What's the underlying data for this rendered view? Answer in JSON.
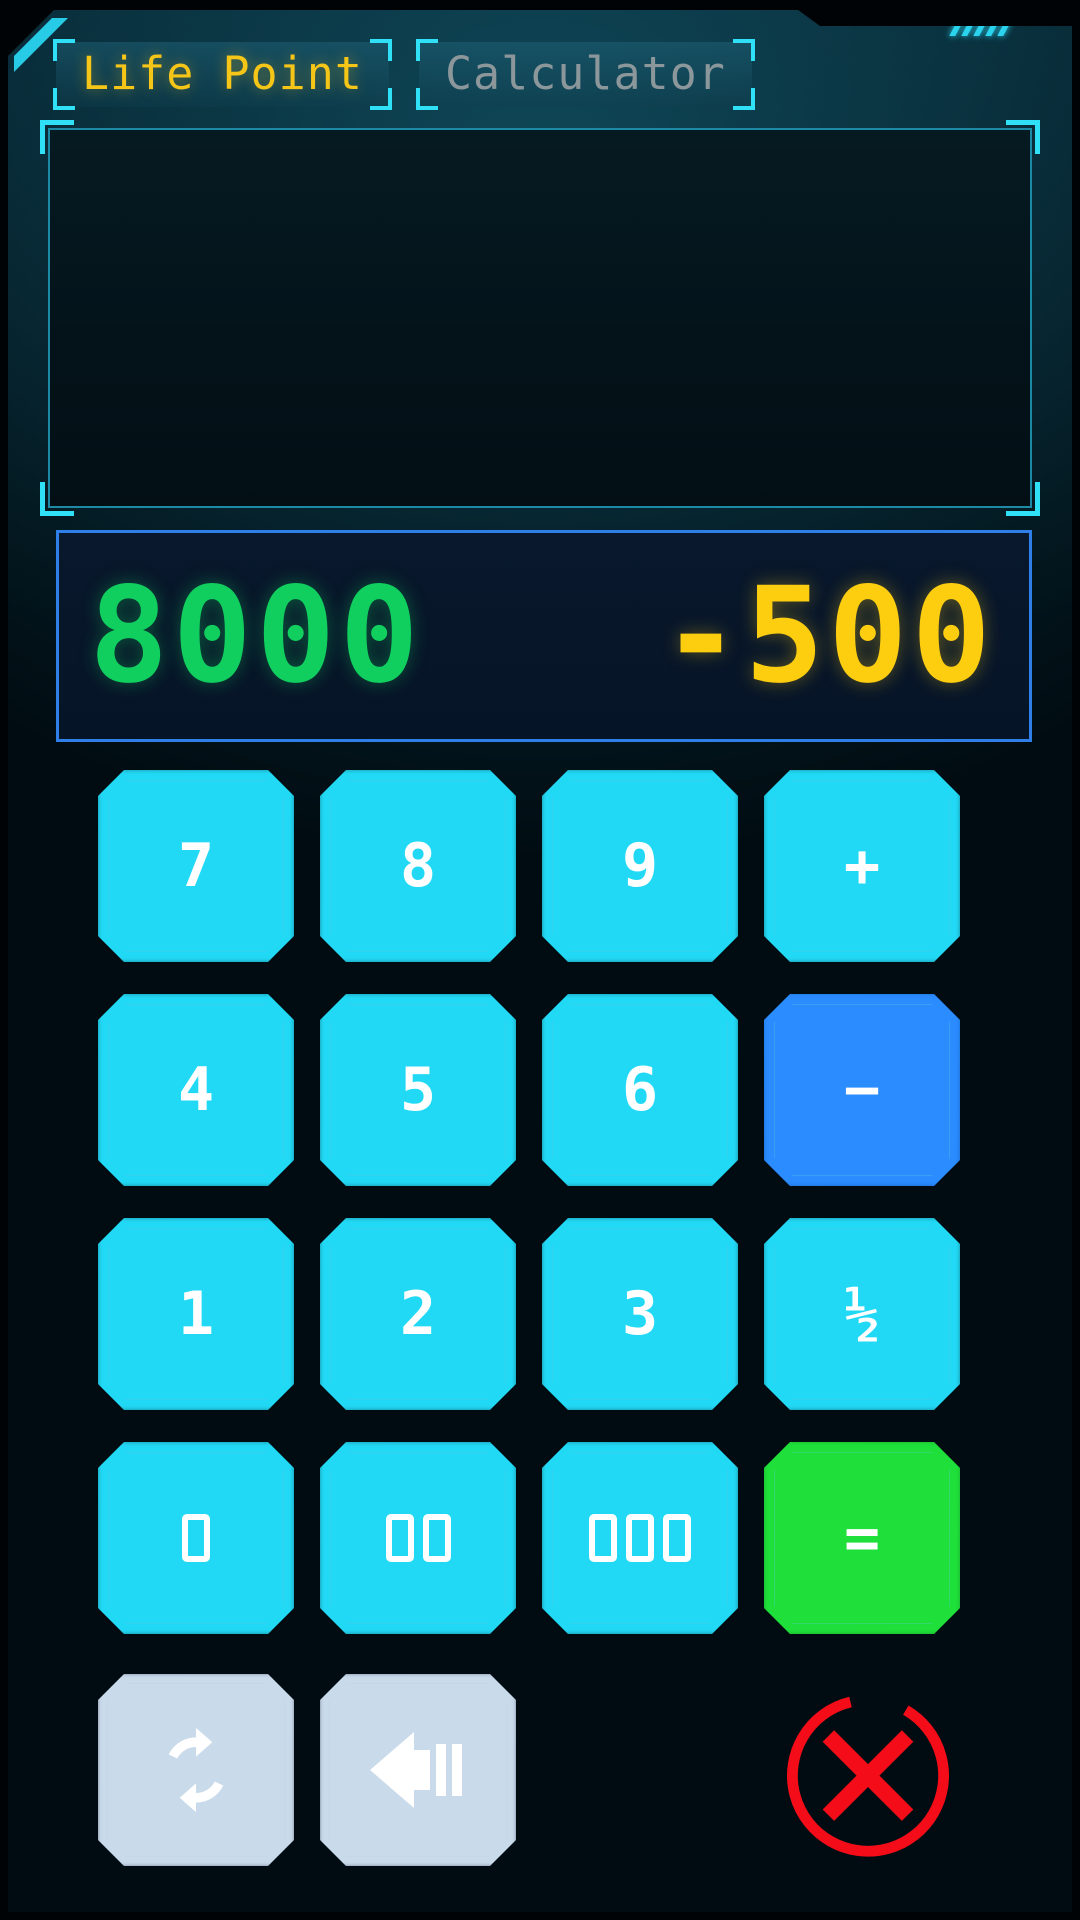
{
  "window": {
    "title": "Life Point Calculator",
    "background_color": "#03171f",
    "accent_color": "#2fe0f7"
  },
  "tabs": [
    {
      "id": "life-point",
      "label": "Life Point",
      "active": true,
      "color": "#f5c518"
    },
    {
      "id": "calculator",
      "label": "Calculator",
      "active": false,
      "color": "#8b979b"
    }
  ],
  "log_panel": {
    "entries": [],
    "empty_text": ""
  },
  "display": {
    "life_points": "8000",
    "life_points_color": "#10cf5e",
    "pending_delta": "-500",
    "pending_delta_color": "#fdcd10",
    "border_color": "#2f7fe8"
  },
  "keypad": [
    {
      "id": "key-7",
      "label": "7",
      "type": "digit",
      "style": "cyan"
    },
    {
      "id": "key-8",
      "label": "8",
      "type": "digit",
      "style": "cyan"
    },
    {
      "id": "key-9",
      "label": "9",
      "type": "digit",
      "style": "cyan"
    },
    {
      "id": "key-plus",
      "label": "+",
      "type": "operator",
      "style": "cyan"
    },
    {
      "id": "key-4",
      "label": "4",
      "type": "digit",
      "style": "cyan"
    },
    {
      "id": "key-5",
      "label": "5",
      "type": "digit",
      "style": "cyan"
    },
    {
      "id": "key-6",
      "label": "6",
      "type": "digit",
      "style": "cyan"
    },
    {
      "id": "key-minus",
      "label": "−",
      "type": "operator",
      "style": "blue-active"
    },
    {
      "id": "key-1",
      "label": "1",
      "type": "digit",
      "style": "cyan"
    },
    {
      "id": "key-2",
      "label": "2",
      "type": "digit",
      "style": "cyan"
    },
    {
      "id": "key-3",
      "label": "3",
      "type": "digit",
      "style": "cyan"
    },
    {
      "id": "key-half",
      "label": "½",
      "type": "operator",
      "style": "cyan"
    },
    {
      "id": "key-0",
      "label": "0",
      "type": "digit",
      "style": "cyan"
    },
    {
      "id": "key-00",
      "label": "00",
      "type": "digit",
      "style": "cyan"
    },
    {
      "id": "key-000",
      "label": "000",
      "type": "digit",
      "style": "cyan"
    },
    {
      "id": "key-equals",
      "label": "=",
      "type": "operator",
      "style": "green-confirm"
    }
  ],
  "actions": {
    "reset": {
      "id": "reset-button",
      "icon": "refresh-cycle-icon",
      "label": ""
    },
    "backspace": {
      "id": "backspace-button",
      "icon": "backspace-arrow-icon",
      "label": ""
    },
    "close": {
      "id": "close-button",
      "icon": "close-circle-x-icon",
      "label": "",
      "color": "#f40d19"
    }
  },
  "colors": {
    "key_border": "#22d9f5",
    "key_fill_top": "#0f4b55",
    "key_fill_bottom": "#093540",
    "minus_fill": "#1463c9",
    "equals_fill": "#1a8f24",
    "action_fill": "#22304c",
    "action_border": "#c9daea",
    "close_red": "#f40d19"
  }
}
